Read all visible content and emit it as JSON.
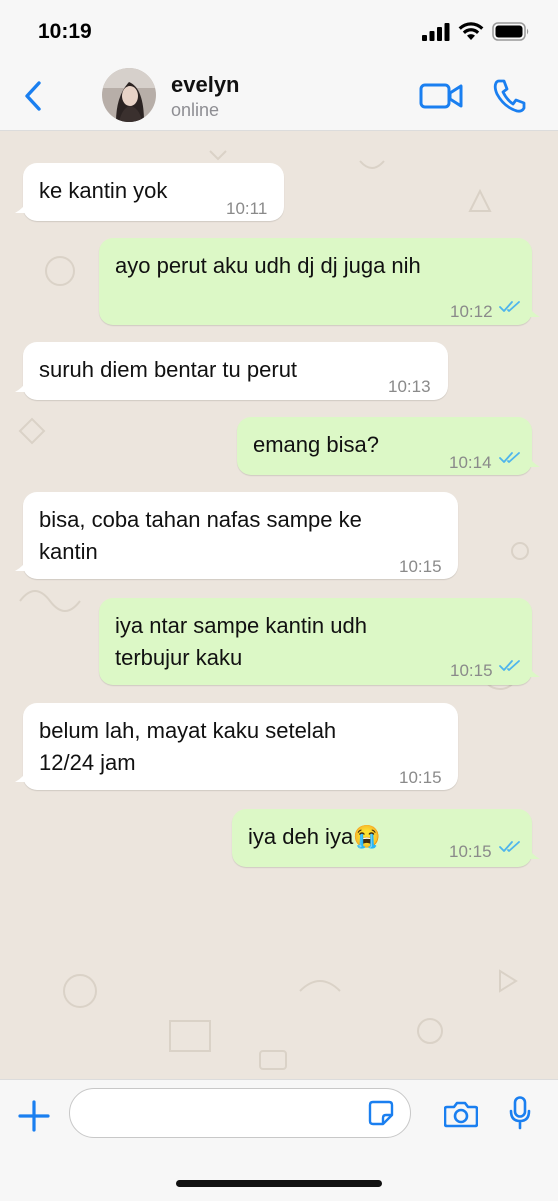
{
  "status_bar": {
    "time": "10:19"
  },
  "contact": {
    "name": "evelyn",
    "status": "online"
  },
  "messages": [
    {
      "direction": "in",
      "text": "ke kantin yok",
      "time": "10:11"
    },
    {
      "direction": "out",
      "text": "ayo perut aku udh dj dj juga nih",
      "time": "10:12",
      "read": true
    },
    {
      "direction": "in",
      "text": "suruh diem bentar tu perut",
      "time": "10:13"
    },
    {
      "direction": "out",
      "text": "emang bisa?",
      "time": "10:14",
      "read": true
    },
    {
      "direction": "in",
      "lines": [
        "bisa, coba tahan nafas sampe ke",
        "kantin"
      ],
      "time": "10:15"
    },
    {
      "direction": "out",
      "lines": [
        "iya ntar sampe kantin udh",
        "terbujur kaku"
      ],
      "time": "10:15",
      "read": true
    },
    {
      "direction": "in",
      "lines": [
        "belum lah, mayat kaku setelah",
        "12/24 jam"
      ],
      "time": "10:15"
    },
    {
      "direction": "out",
      "text": "iya deh iya😭",
      "time": "10:15",
      "read": true
    }
  ],
  "input": {
    "value": "",
    "placeholder": ""
  },
  "icons": {
    "back": "chevron-left-icon",
    "video": "video-camera-icon",
    "call": "phone-icon",
    "add": "plus-icon",
    "sticker": "sticker-icon",
    "camera": "camera-icon",
    "mic": "microphone-icon",
    "read_receipt": "double-check-icon"
  },
  "colors": {
    "accent": "#1a7ff0",
    "incoming_bubble": "#ffffff",
    "outgoing_bubble": "#dcf8c6",
    "chat_background": "#ece5dd",
    "read_tick": "#4fb5ec"
  }
}
